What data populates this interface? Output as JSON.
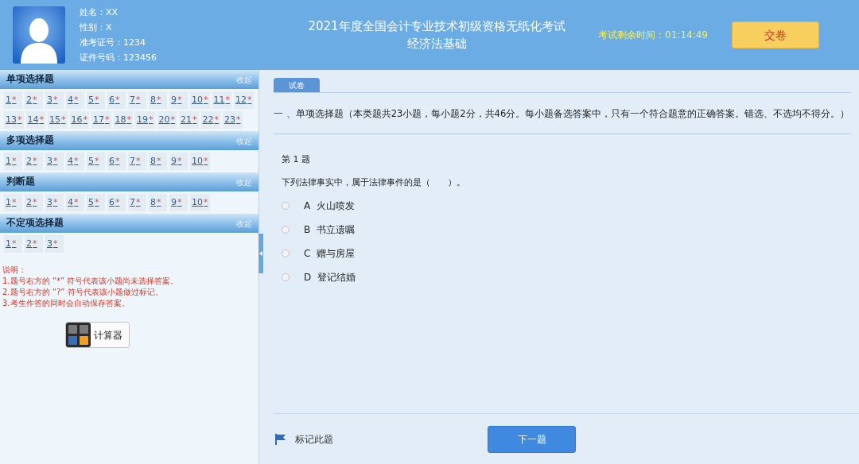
{
  "candidate": {
    "fields": [
      {
        "label": "姓名：",
        "value": "XX"
      },
      {
        "label": "性别：",
        "value": "X"
      },
      {
        "label": "准考证号：",
        "value": "1234"
      },
      {
        "label": "证件号码：",
        "value": "123456"
      }
    ]
  },
  "exam": {
    "title": "2021年度全国会计专业技术初级资格无纸化考试",
    "subject": "经济法基础"
  },
  "timer": {
    "label": "考试剩余时间：",
    "value": "01:14:49"
  },
  "submit_button": "交卷",
  "sections": [
    {
      "title": "单项选择题",
      "collapse": "收起",
      "questions": [
        {
          "number": "1",
          "mark": "*"
        },
        {
          "number": "2",
          "mark": "*"
        },
        {
          "number": "3",
          "mark": "*"
        },
        {
          "number": "4",
          "mark": "*"
        },
        {
          "number": "5",
          "mark": "*"
        },
        {
          "number": "6",
          "mark": "*"
        },
        {
          "number": "7",
          "mark": "*"
        },
        {
          "number": "8",
          "mark": "*"
        },
        {
          "number": "9",
          "mark": "*"
        },
        {
          "number": "10",
          "mark": "*"
        },
        {
          "number": "11",
          "mark": "*"
        },
        {
          "number": "12",
          "mark": "*"
        },
        {
          "number": "13",
          "mark": "*"
        },
        {
          "number": "14",
          "mark": "*"
        },
        {
          "number": "15",
          "mark": "*"
        },
        {
          "number": "16",
          "mark": "*"
        },
        {
          "number": "17",
          "mark": "*"
        },
        {
          "number": "18",
          "mark": "*"
        },
        {
          "number": "19",
          "mark": "*"
        },
        {
          "number": "20",
          "mark": "*"
        },
        {
          "number": "21",
          "mark": "*"
        },
        {
          "number": "22",
          "mark": "*"
        },
        {
          "number": "23",
          "mark": "*"
        }
      ]
    },
    {
      "title": "多项选择题",
      "collapse": "收起",
      "questions": [
        {
          "number": "1",
          "mark": "*"
        },
        {
          "number": "2",
          "mark": "*"
        },
        {
          "number": "3",
          "mark": "*"
        },
        {
          "number": "4",
          "mark": "*"
        },
        {
          "number": "5",
          "mark": "*"
        },
        {
          "number": "6",
          "mark": "*"
        },
        {
          "number": "7",
          "mark": "*"
        },
        {
          "number": "8",
          "mark": "*"
        },
        {
          "number": "9",
          "mark": "*"
        },
        {
          "number": "10",
          "mark": "*"
        }
      ]
    },
    {
      "title": "判断题",
      "collapse": "收起",
      "questions": [
        {
          "number": "1",
          "mark": "*"
        },
        {
          "number": "2",
          "mark": "*"
        },
        {
          "number": "3",
          "mark": "*"
        },
        {
          "number": "4",
          "mark": "*"
        },
        {
          "number": "5",
          "mark": "*"
        },
        {
          "number": "6",
          "mark": "*"
        },
        {
          "number": "7",
          "mark": "*"
        },
        {
          "number": "8",
          "mark": "*"
        },
        {
          "number": "9",
          "mark": "*"
        },
        {
          "number": "10",
          "mark": "*"
        }
      ]
    },
    {
      "title": "不定项选择题",
      "collapse": "收起",
      "questions": [
        {
          "number": "1",
          "mark": "*"
        },
        {
          "number": "2",
          "mark": "*"
        },
        {
          "number": "3",
          "mark": "*"
        }
      ]
    }
  ],
  "notes": [
    "说明：",
    "1.题号右方的 “*” 符号代表该小题尚未选择答案。",
    "2.题号右方的 “?” 符号代表该小题做过标记。",
    "3.考生作答的同时会自动保存答案。"
  ],
  "calculator_button": "计算器",
  "tabs": [
    {
      "label": "试卷",
      "selected": true
    }
  ],
  "section_instruction": "一 、单项选择题（本类题共23小题，每小题2分，共46分。每小题备选答案中，只有一个符合题意的正确答案。错选、不选均不得分。）",
  "question": {
    "number": "第 1 题",
    "text": "下列法律事实中，属于法律事件的是（　　）。",
    "options": [
      {
        "letter": "A",
        "text": "火山喷发",
        "selected": false
      },
      {
        "letter": "B",
        "text": "书立遗嘱",
        "selected": false
      },
      {
        "letter": "C",
        "text": "赠与房屋",
        "selected": false
      },
      {
        "letter": "D",
        "text": "登记结婚",
        "selected": false
      }
    ]
  },
  "mark_button": "标记此题",
  "next_button": "下一题"
}
